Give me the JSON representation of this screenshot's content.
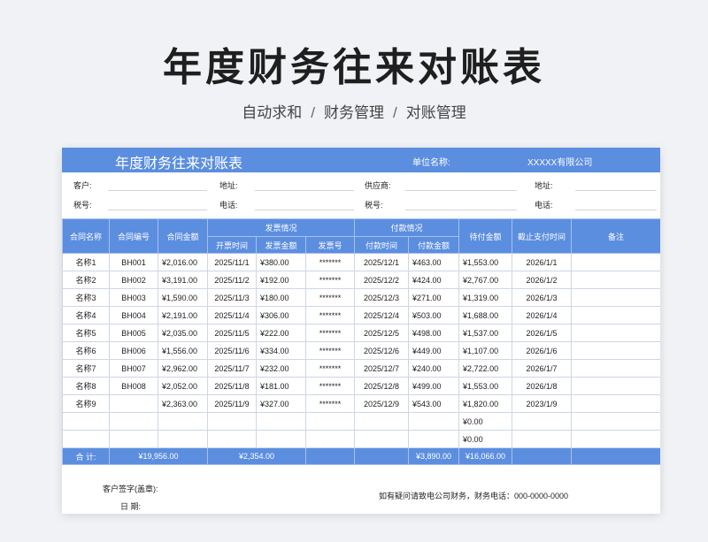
{
  "page_title": "年度财务往来对账表",
  "breadcrumb": [
    "自动求和",
    "财务管理",
    "对账管理"
  ],
  "breadcrumb_sep": "/",
  "sheet": {
    "title": "年度财务往来对账表",
    "unit_label": "单位名称:",
    "unit_value": "XXXXX有限公司",
    "info": {
      "customer": "客户:",
      "address1": "地址:",
      "supplier": "供应商:",
      "address2": "地址:",
      "tax1": "税号:",
      "phone1": "电话:",
      "tax2": "税号:",
      "phone2": "电话:"
    },
    "headers": {
      "contract_name": "合同名称",
      "contract_no": "合同编号",
      "contract_amount": "合同金额",
      "invoice_group": "发票情况",
      "invoice_date": "开票时间",
      "invoice_amount": "发票金额",
      "invoice_no": "发票号",
      "payment_group": "付款情况",
      "pay_date": "付款时间",
      "pay_amount": "付款金额",
      "due_amount": "待付金额",
      "deadline": "截止支付时间",
      "remark": "备注"
    },
    "rows": [
      {
        "name": "名称1",
        "no": "BH001",
        "amount": "¥2,016.00",
        "inv_date": "2025/11/1",
        "inv_amount": "¥380.00",
        "inv_no": "*******",
        "pay_date": "2025/12/1",
        "pay_amount": "¥463.00",
        "due": "¥1,553.00",
        "deadline": "2026/1/1",
        "remark": ""
      },
      {
        "name": "名称2",
        "no": "BH002",
        "amount": "¥3,191.00",
        "inv_date": "2025/11/2",
        "inv_amount": "¥192.00",
        "inv_no": "*******",
        "pay_date": "2025/12/2",
        "pay_amount": "¥424.00",
        "due": "¥2,767.00",
        "deadline": "2026/1/2",
        "remark": ""
      },
      {
        "name": "名称3",
        "no": "BH003",
        "amount": "¥1,590.00",
        "inv_date": "2025/11/3",
        "inv_amount": "¥180.00",
        "inv_no": "*******",
        "pay_date": "2025/12/3",
        "pay_amount": "¥271.00",
        "due": "¥1,319.00",
        "deadline": "2026/1/3",
        "remark": ""
      },
      {
        "name": "名称4",
        "no": "BH004",
        "amount": "¥2,191.00",
        "inv_date": "2025/11/4",
        "inv_amount": "¥306.00",
        "inv_no": "*******",
        "pay_date": "2025/12/4",
        "pay_amount": "¥503.00",
        "due": "¥1,688.00",
        "deadline": "2026/1/4",
        "remark": ""
      },
      {
        "name": "名称5",
        "no": "BH005",
        "amount": "¥2,035.00",
        "inv_date": "2025/11/5",
        "inv_amount": "¥222.00",
        "inv_no": "*******",
        "pay_date": "2025/12/5",
        "pay_amount": "¥498.00",
        "due": "¥1,537.00",
        "deadline": "2026/1/5",
        "remark": ""
      },
      {
        "name": "名称6",
        "no": "BH006",
        "amount": "¥1,556.00",
        "inv_date": "2025/11/6",
        "inv_amount": "¥334.00",
        "inv_no": "*******",
        "pay_date": "2025/12/6",
        "pay_amount": "¥449.00",
        "due": "¥1,107.00",
        "deadline": "2026/1/6",
        "remark": ""
      },
      {
        "name": "名称7",
        "no": "BH007",
        "amount": "¥2,962.00",
        "inv_date": "2025/11/7",
        "inv_amount": "¥232.00",
        "inv_no": "*******",
        "pay_date": "2025/12/7",
        "pay_amount": "¥240.00",
        "due": "¥2,722.00",
        "deadline": "2026/1/7",
        "remark": ""
      },
      {
        "name": "名称8",
        "no": "BH008",
        "amount": "¥2,052.00",
        "inv_date": "2025/11/8",
        "inv_amount": "¥181.00",
        "inv_no": "*******",
        "pay_date": "2025/12/8",
        "pay_amount": "¥499.00",
        "due": "¥1,553.00",
        "deadline": "2026/1/8",
        "remark": ""
      },
      {
        "name": "名称9",
        "no": "",
        "amount": "¥2,363.00",
        "inv_date": "2025/11/9",
        "inv_amount": "¥327.00",
        "inv_no": "*******",
        "pay_date": "2025/12/9",
        "pay_amount": "¥543.00",
        "due": "¥1,820.00",
        "deadline": "2023/1/9",
        "remark": ""
      },
      {
        "name": "",
        "no": "",
        "amount": "",
        "inv_date": "",
        "inv_amount": "",
        "inv_no": "",
        "pay_date": "",
        "pay_amount": "",
        "due": "¥0.00",
        "deadline": "",
        "remark": ""
      },
      {
        "name": "",
        "no": "",
        "amount": "",
        "inv_date": "",
        "inv_amount": "",
        "inv_no": "",
        "pay_date": "",
        "pay_amount": "",
        "due": "¥0.00",
        "deadline": "",
        "remark": ""
      }
    ],
    "total": {
      "label": "合  计:",
      "amount": "¥19,956.00",
      "inv_amount": "¥2,354.00",
      "pay_amount": "¥3,890.00",
      "due": "¥16,066.00"
    },
    "footer": {
      "sign_label": "客户签字(盖章):",
      "date_label": "日    期:",
      "contact": "如有疑问请致电公司财务，财务电话：000-0000-0000"
    }
  }
}
